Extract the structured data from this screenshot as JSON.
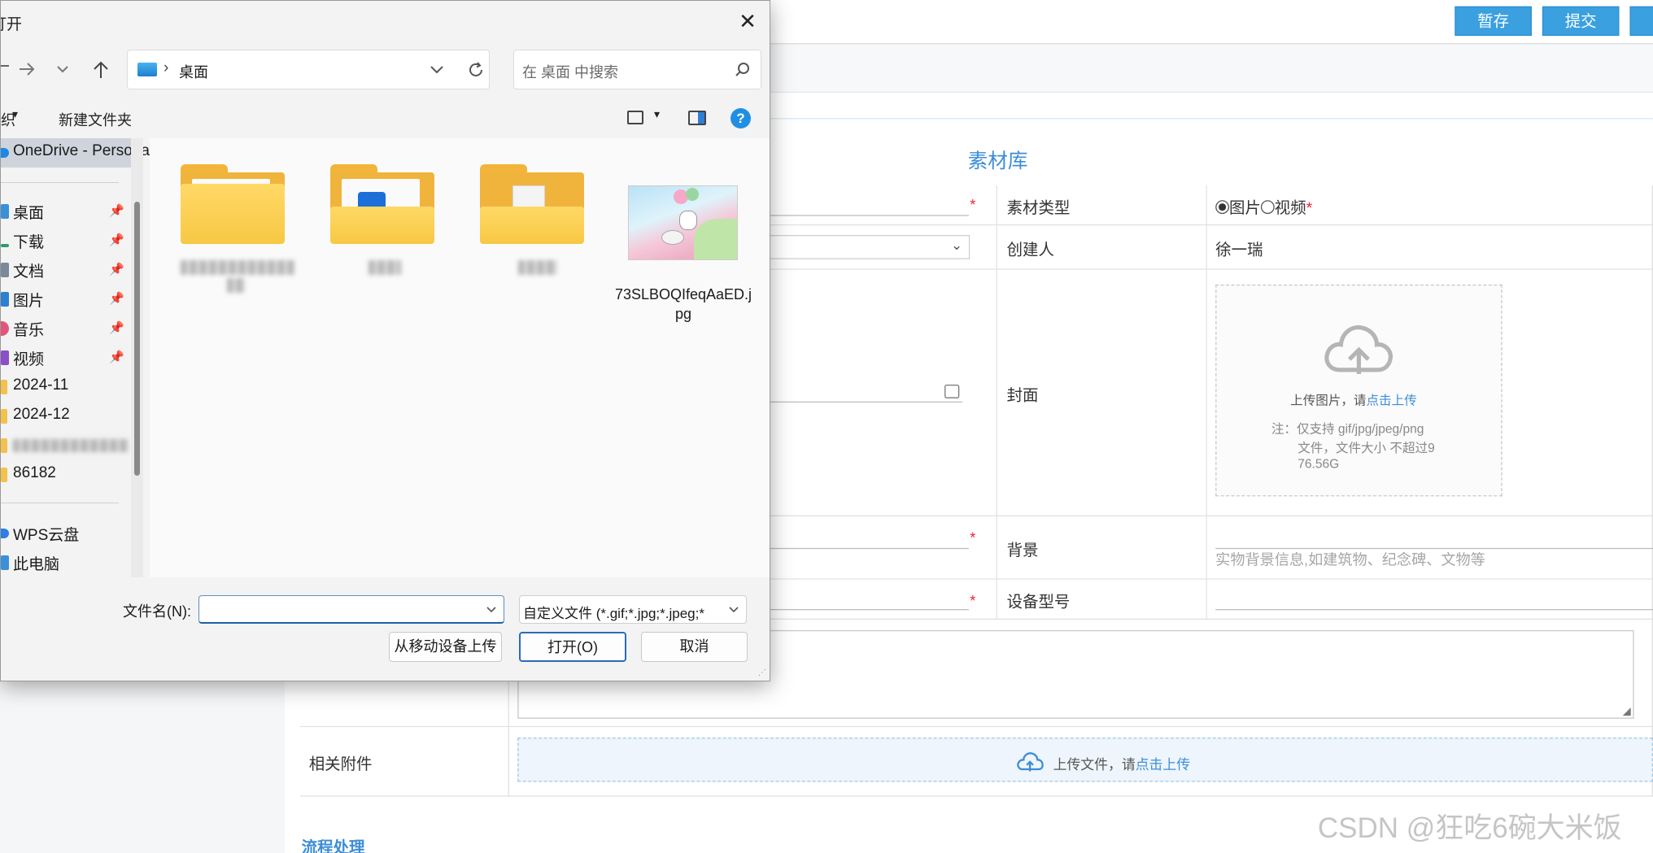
{
  "web": {
    "topbar": {
      "save_label": "暂存",
      "submit_label": "提交"
    },
    "section_title": "素材库",
    "form": {
      "material_type_label": "素材类型",
      "material_type_option_image": "图片",
      "material_type_option_video": "视频",
      "material_type_selected": "图片",
      "required_mark": "*",
      "creator_label": "创建人",
      "creator_value": "徐一瑞",
      "cover_label": "封面",
      "cover_upload_text": "上传图片，请",
      "cover_upload_link": "点击上传",
      "cover_note_line1": "注：仅支持 gif/jpg/jpeg/png",
      "cover_note_line2": "文件，文件大小 不超过9",
      "cover_note_line3": "76.56G",
      "background_label": "背景",
      "background_placeholder": "实物背景信息,如建筑物、纪念碑、文物等",
      "device_model_label": "设备型号",
      "attachments_label": "相关附件",
      "attach_upload_text": "上传文件，请",
      "attach_upload_link": "点击上传"
    },
    "flow_title": "流程处理",
    "watermark": "CSDN @狂吃6碗大米饭"
  },
  "dialog": {
    "title": "打开",
    "close_glyph": "✕",
    "address": {
      "location": "桌面",
      "separator": "›"
    },
    "search_placeholder": "在 桌面 中搜索",
    "commands": {
      "organize": "组织",
      "new_folder": "新建文件夹"
    },
    "nav_items": [
      {
        "label": "OneDrive - Personal",
        "icon_color": "#1e88e5",
        "pinned": false
      },
      {
        "label": "桌面",
        "icon_color": "#3a8fd8",
        "pinned": true
      },
      {
        "label": "下载",
        "icon_color": "#2a9d6a",
        "pinned": true
      },
      {
        "label": "文档",
        "icon_color": "#7a8a9a",
        "pinned": true
      },
      {
        "label": "图片",
        "icon_color": "#2d7fd0",
        "pinned": true
      },
      {
        "label": "音乐",
        "icon_color": "#e0567a",
        "pinned": true
      },
      {
        "label": "视频",
        "icon_color": "#8a4fc9",
        "pinned": true
      },
      {
        "label": "2024-11",
        "icon_color": "#f2c14e",
        "pinned": false
      },
      {
        "label": "2024-12",
        "icon_color": "#f2c14e",
        "pinned": false
      },
      {
        "label": "86182",
        "icon_color": "#f2c14e",
        "pinned": false
      },
      {
        "label": "WPS云盘",
        "icon_color": "#2f7de1",
        "pinned": false
      },
      {
        "label": "此电脑",
        "icon_color": "#3a8fd8",
        "pinned": false
      }
    ],
    "files": [
      {
        "kind": "folder",
        "badge": "none"
      },
      {
        "kind": "folder",
        "badge": "app"
      },
      {
        "kind": "folder",
        "badge": "doc"
      },
      {
        "kind": "image",
        "name": "73SLBOQIfeqAaED.jpg"
      }
    ],
    "filename_label": "文件名(N):",
    "filename_value": "",
    "filetype_value": "自定义文件 (*.gif;*.jpg;*.jpeg;*",
    "buttons": {
      "upload_mobile": "从移动设备上传",
      "open": "打开(O)",
      "cancel": "取消"
    },
    "icons": {
      "back": "back-arrow-icon",
      "forward": "forward-arrow-icon",
      "recent": "chevron-down-icon",
      "up": "up-arrow-icon",
      "refresh": "refresh-icon",
      "search": "search-icon",
      "help": "help-icon",
      "pin": "pin-icon"
    }
  }
}
